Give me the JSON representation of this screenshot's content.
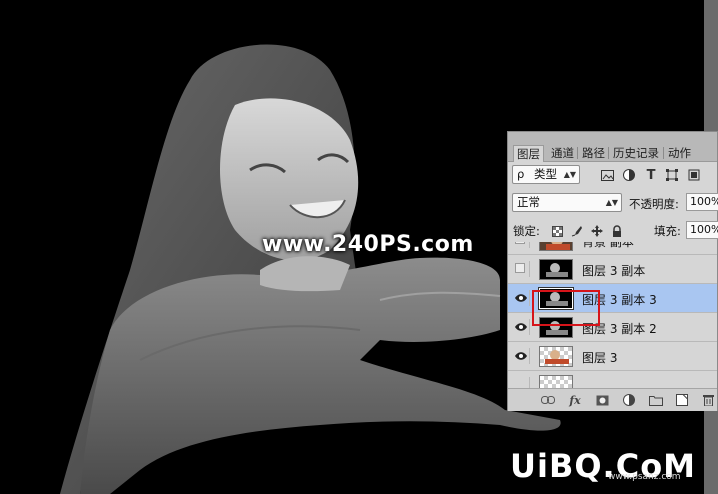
{
  "watermark": "www.240PS.com",
  "brand": {
    "main": "UiBQ.CoM",
    "sub": "www.psanz.com"
  },
  "layers_panel": {
    "tabs": [
      {
        "label": "图层",
        "active": true
      },
      {
        "label": "通道",
        "active": false
      },
      {
        "label": "路径",
        "active": false
      },
      {
        "label": "历史记录",
        "active": false
      },
      {
        "label": "动作",
        "active": false
      }
    ],
    "filter": {
      "search_glyph": "ρ",
      "value": "类型"
    },
    "blend_mode": "正常",
    "opacity": {
      "label": "不透明度:",
      "value": "100%"
    },
    "lock": {
      "label": "锁定:"
    },
    "fill": {
      "label": "填充:",
      "value": "100%"
    },
    "layers": [
      {
        "name": "背景 副本",
        "visible": false,
        "selected": false,
        "thumb": "photo-color"
      },
      {
        "name": "图层 3 副本",
        "visible": false,
        "selected": false,
        "thumb": "bw"
      },
      {
        "name": "图层 3 副本 3",
        "visible": true,
        "selected": true,
        "thumb": "bw"
      },
      {
        "name": "图层 3 副本 2",
        "visible": true,
        "selected": false,
        "thumb": "bw"
      },
      {
        "name": "图层 3",
        "visible": true,
        "selected": false,
        "thumb": "color-checker"
      }
    ],
    "footer_icons": [
      "link-icon",
      "fx-icon",
      "mask-icon",
      "adjustment-icon",
      "folder-icon",
      "new-layer-icon",
      "trash-icon"
    ]
  },
  "colors": {
    "selected_row": "#a9c6f1",
    "highlight_box": "#d6141a",
    "panel_bg": "#d6d6d6"
  }
}
